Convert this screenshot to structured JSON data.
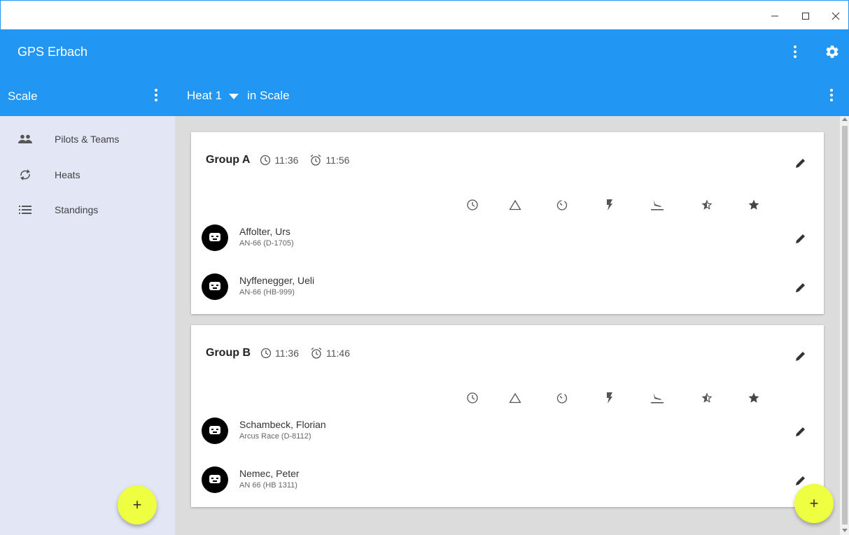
{
  "window": {
    "minimize": "–",
    "maximize": "☐",
    "close": "✕"
  },
  "app": {
    "title": "GPS Erbach"
  },
  "subbar": {
    "section": "Scale",
    "heat": "Heat 1",
    "in_label": "in Scale"
  },
  "sidebar": {
    "items": [
      {
        "label": "Pilots & Teams",
        "icon": "people-icon"
      },
      {
        "label": "Heats",
        "icon": "sync-icon"
      },
      {
        "label": "Standings",
        "icon": "list-icon"
      }
    ],
    "fab_label": "+"
  },
  "main": {
    "fab_label": "+",
    "groups": [
      {
        "name": "Group A",
        "start": "11:36",
        "alarm": "11:56",
        "pilots": [
          {
            "name": "Affolter, Urs",
            "plane": "AN-66 (D-1705)"
          },
          {
            "name": "Nyffenegger, Ueli",
            "plane": "AN-66 (HB-999)"
          }
        ]
      },
      {
        "name": "Group B",
        "start": "11:36",
        "alarm": "11:46",
        "pilots": [
          {
            "name": "Schambeck, Florian",
            "plane": "Arcus Race (D-8112)"
          },
          {
            "name": "Nemec, Peter",
            "plane": "AN 66 (HB 1311)"
          }
        ]
      }
    ],
    "column_icons": [
      "clock-icon",
      "triangle-icon",
      "timer-icon",
      "lightning-icon",
      "landing-icon",
      "half-star-icon",
      "star-icon"
    ]
  },
  "colors": {
    "primary": "#2196F3",
    "accent": "#EEFF41",
    "sidebar": "#E3E6F4",
    "content": "#DCDCDC"
  }
}
